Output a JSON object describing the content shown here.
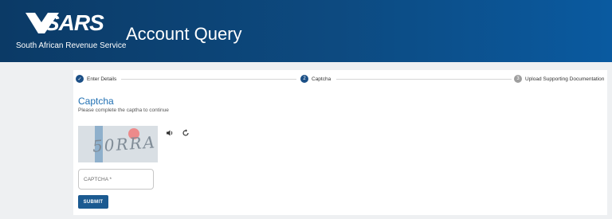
{
  "header": {
    "logo_text": "SARS",
    "org_name": "South African Revenue Service",
    "title": "Account Query"
  },
  "stepper": {
    "steps": [
      {
        "number": "✓",
        "label": "Enter Details",
        "state": "done",
        "color": "#1b4f86"
      },
      {
        "number": "2",
        "label": "Captcha",
        "state": "active",
        "color": "#1b4f86"
      },
      {
        "number": "3",
        "label": "Upload Supporting Documentation",
        "state": "pending",
        "color": "#9e9e9e"
      }
    ]
  },
  "card": {
    "title": "Captcha",
    "subtitle": "Please complete the captha to continue",
    "captcha_text": "50RRA",
    "audio_icon": "speaker-icon",
    "refresh_icon": "refresh-icon",
    "input_placeholder": "CAPTCHA *",
    "submit_label": "SUBMIT"
  },
  "colors": {
    "brand": "#0d4a80",
    "accent": "#1f6fb2",
    "button": "#1b5a91"
  }
}
